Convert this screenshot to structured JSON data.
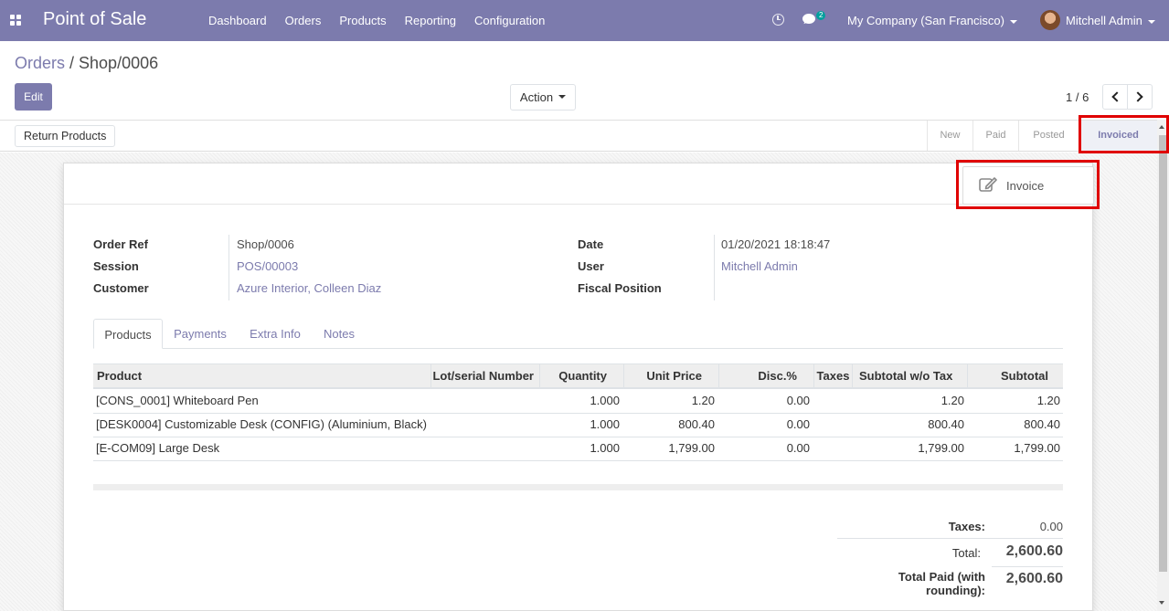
{
  "navbar": {
    "app_name": "Point of Sale",
    "menu": [
      "Dashboard",
      "Orders",
      "Products",
      "Reporting",
      "Configuration"
    ],
    "chat_count": "2",
    "company": "My Company (San Francisco)",
    "user": "Mitchell Admin"
  },
  "breadcrumb": {
    "parent": "Orders",
    "separator": " / ",
    "current": "Shop/0006"
  },
  "control_panel": {
    "edit_label": "Edit",
    "action_label": "Action",
    "pager": "1 / 6"
  },
  "statusbar": {
    "return_label": "Return Products",
    "stages": [
      "New",
      "Paid",
      "Posted",
      "Invoiced"
    ],
    "active_stage": "Invoiced"
  },
  "smart_button": {
    "invoice_label": "Invoice"
  },
  "fields": {
    "order_ref_label": "Order Ref",
    "order_ref": "Shop/0006",
    "session_label": "Session",
    "session": "POS/00003",
    "customer_label": "Customer",
    "customer": "Azure Interior, Colleen Diaz",
    "date_label": "Date",
    "date": "01/20/2021 18:18:47",
    "user_label": "User",
    "user": "Mitchell Admin",
    "fiscal_label": "Fiscal Position",
    "fiscal": ""
  },
  "tabs": [
    "Products",
    "Payments",
    "Extra Info",
    "Notes"
  ],
  "table": {
    "headers": [
      "Product",
      "Lot/serial Number",
      "Quantity",
      "Unit Price",
      "Disc.%",
      "Taxes",
      "Subtotal w/o Tax",
      "Subtotal"
    ],
    "rows": [
      [
        "[CONS_0001] Whiteboard Pen",
        "",
        "1.000",
        "1.20",
        "0.00",
        "",
        "1.20",
        "1.20"
      ],
      [
        "[DESK0004] Customizable Desk (CONFIG) (Aluminium, Black)",
        "",
        "1.000",
        "800.40",
        "0.00",
        "",
        "800.40",
        "800.40"
      ],
      [
        "[E-COM09] Large Desk",
        "",
        "1.000",
        "1,799.00",
        "0.00",
        "",
        "1,799.00",
        "1,799.00"
      ]
    ]
  },
  "totals": {
    "taxes_label": "Taxes:",
    "taxes": "0.00",
    "total_label": "Total:",
    "total": "2,600.60",
    "paid_label": "Total Paid (with rounding):",
    "paid": "2,600.60"
  },
  "colors": {
    "brand": "#7c7bad",
    "highlight": "#e00000"
  }
}
